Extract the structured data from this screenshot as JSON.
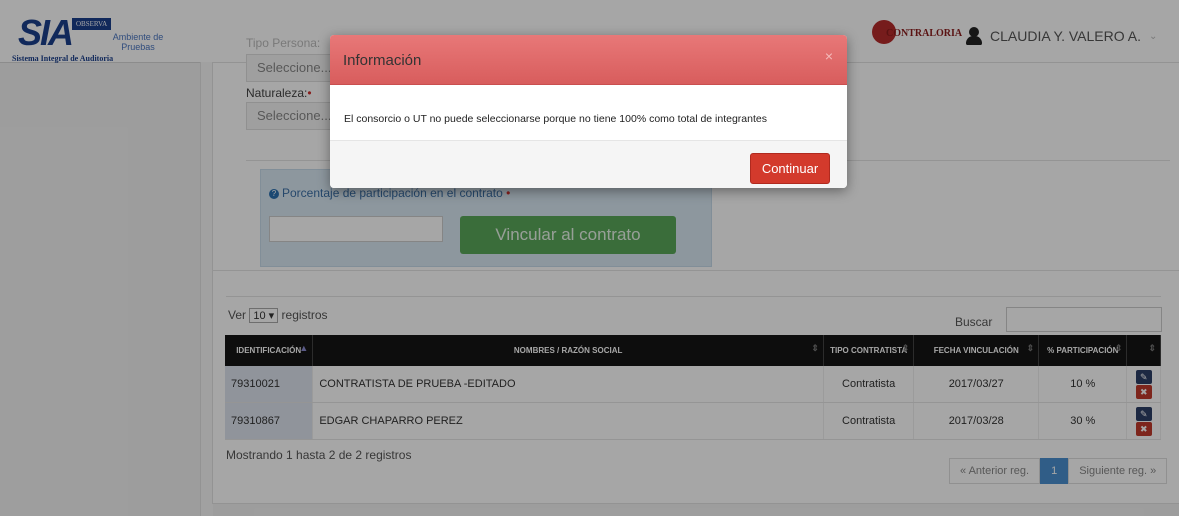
{
  "brand": {
    "logo_text": "SIA",
    "logo_badge": "OBSERVA",
    "subtitle": "Sistema Integral de Auditoria",
    "environment": "Ambiente de Pruebas"
  },
  "header": {
    "partner_logo": "CONTRALORIA",
    "user_name": "CLAUDIA Y. VALERO A."
  },
  "form": {
    "tipo_persona_label": "Tipo Persona:",
    "tipo_persona_value": "Seleccione...",
    "naturaleza_label": "Naturaleza:",
    "naturaleza_value": "Seleccione...",
    "porcentaje_label": "Porcentaje de participación en el contrato",
    "link_button": "Vincular al contrato"
  },
  "table_controls": {
    "ver_label": "Ver",
    "ver_value": "10",
    "registros_label": "registros",
    "search_label": "Buscar"
  },
  "table": {
    "headers": [
      "IDENTIFICACIÓN",
      "NOMBRES / RAZÓN SOCIAL",
      "TIPO CONTRATISTA",
      "FECHA VINCULACIÓN",
      "% PARTICIPACIÓN"
    ],
    "rows": [
      {
        "id": "79310021",
        "name": "CONTRATISTA DE PRUEBA -EDITADO",
        "tipo": "Contratista",
        "fecha": "2017/03/27",
        "participacion": "10 %"
      },
      {
        "id": "79310867",
        "name": "EDGAR CHAPARRO PEREZ",
        "tipo": "Contratista",
        "fecha": "2017/03/28",
        "participacion": "30 %"
      }
    ],
    "showing": "Mostrando 1 hasta 2 de 2 registros"
  },
  "pager": {
    "prev": "« Anterior reg.",
    "current": "1",
    "next": "Siguiente reg. »"
  },
  "modal": {
    "title": "Información",
    "message": "El consorcio o UT no puede seleccionarse porque no tiene 100% como total de integrantes",
    "button": "Continuar",
    "close": "×"
  },
  "colors": {
    "modal_header": "#de6666",
    "button_danger": "#d33a2c",
    "link_button": "#5aa85a",
    "brand_blue": "#1b3f8c"
  }
}
